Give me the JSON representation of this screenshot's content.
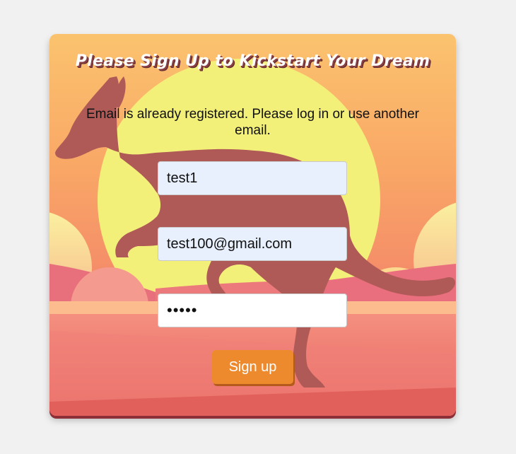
{
  "form": {
    "title": "Please Sign Up to Kickstart Your Dream",
    "error_message": "Email is already registered. Please log in or use another email.",
    "username_value": "test1",
    "email_value": "test100@gmail.com",
    "password_value": "12345",
    "signup_label": "Sign up"
  },
  "theme": {
    "sky_top": "#fbc36e",
    "sky_bottom": "#f3866a",
    "sun": "#f3f07a",
    "kangaroo": "#b05a57",
    "ground": "#ee7171",
    "button": "#ee8a2e",
    "autofill_bg": "#e8f0fe"
  },
  "background_art": {
    "icons": [
      "sun-icon",
      "kangaroo-icon",
      "hills-icon"
    ]
  }
}
